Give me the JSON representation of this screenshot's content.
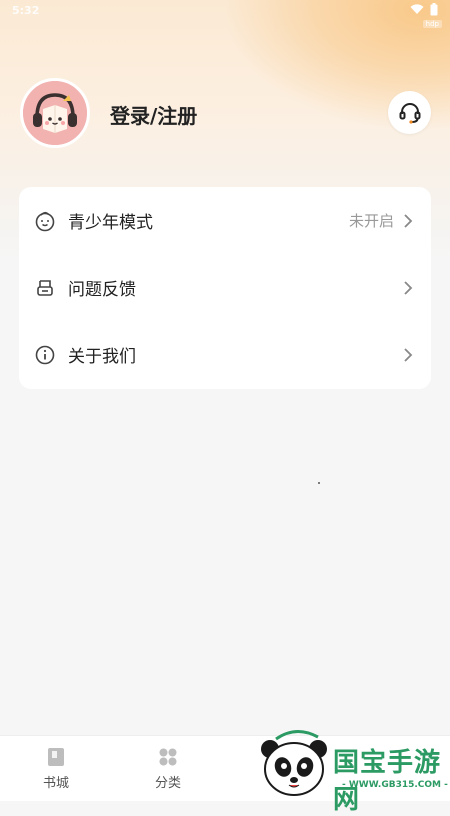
{
  "status_bar": {
    "time": "5:32",
    "tag": "hdp"
  },
  "profile": {
    "login_label": "登录/注册",
    "avatar_icon": "headphone-book-mascot-icon",
    "service_icon": "customer-service-headset-icon"
  },
  "menu": {
    "items": [
      {
        "icon": "child-face-icon",
        "label": "青少年模式",
        "value": "未开启"
      },
      {
        "icon": "feedback-box-icon",
        "label": "问题反馈",
        "value": ""
      },
      {
        "icon": "info-circle-icon",
        "label": "关于我们",
        "value": ""
      }
    ]
  },
  "tabbar": {
    "tabs": [
      {
        "icon": "book-icon",
        "label": "书城"
      },
      {
        "icon": "category-grid-icon",
        "label": "分类"
      }
    ]
  },
  "watermark": {
    "title": "国宝手游网",
    "url": "- WWW.GB315.COM -",
    "icon": "panda-logo-icon"
  },
  "colors": {
    "accent_peach": "#f9c98a",
    "watermark_green": "#2c9a63",
    "background": "#f6f6f6"
  }
}
